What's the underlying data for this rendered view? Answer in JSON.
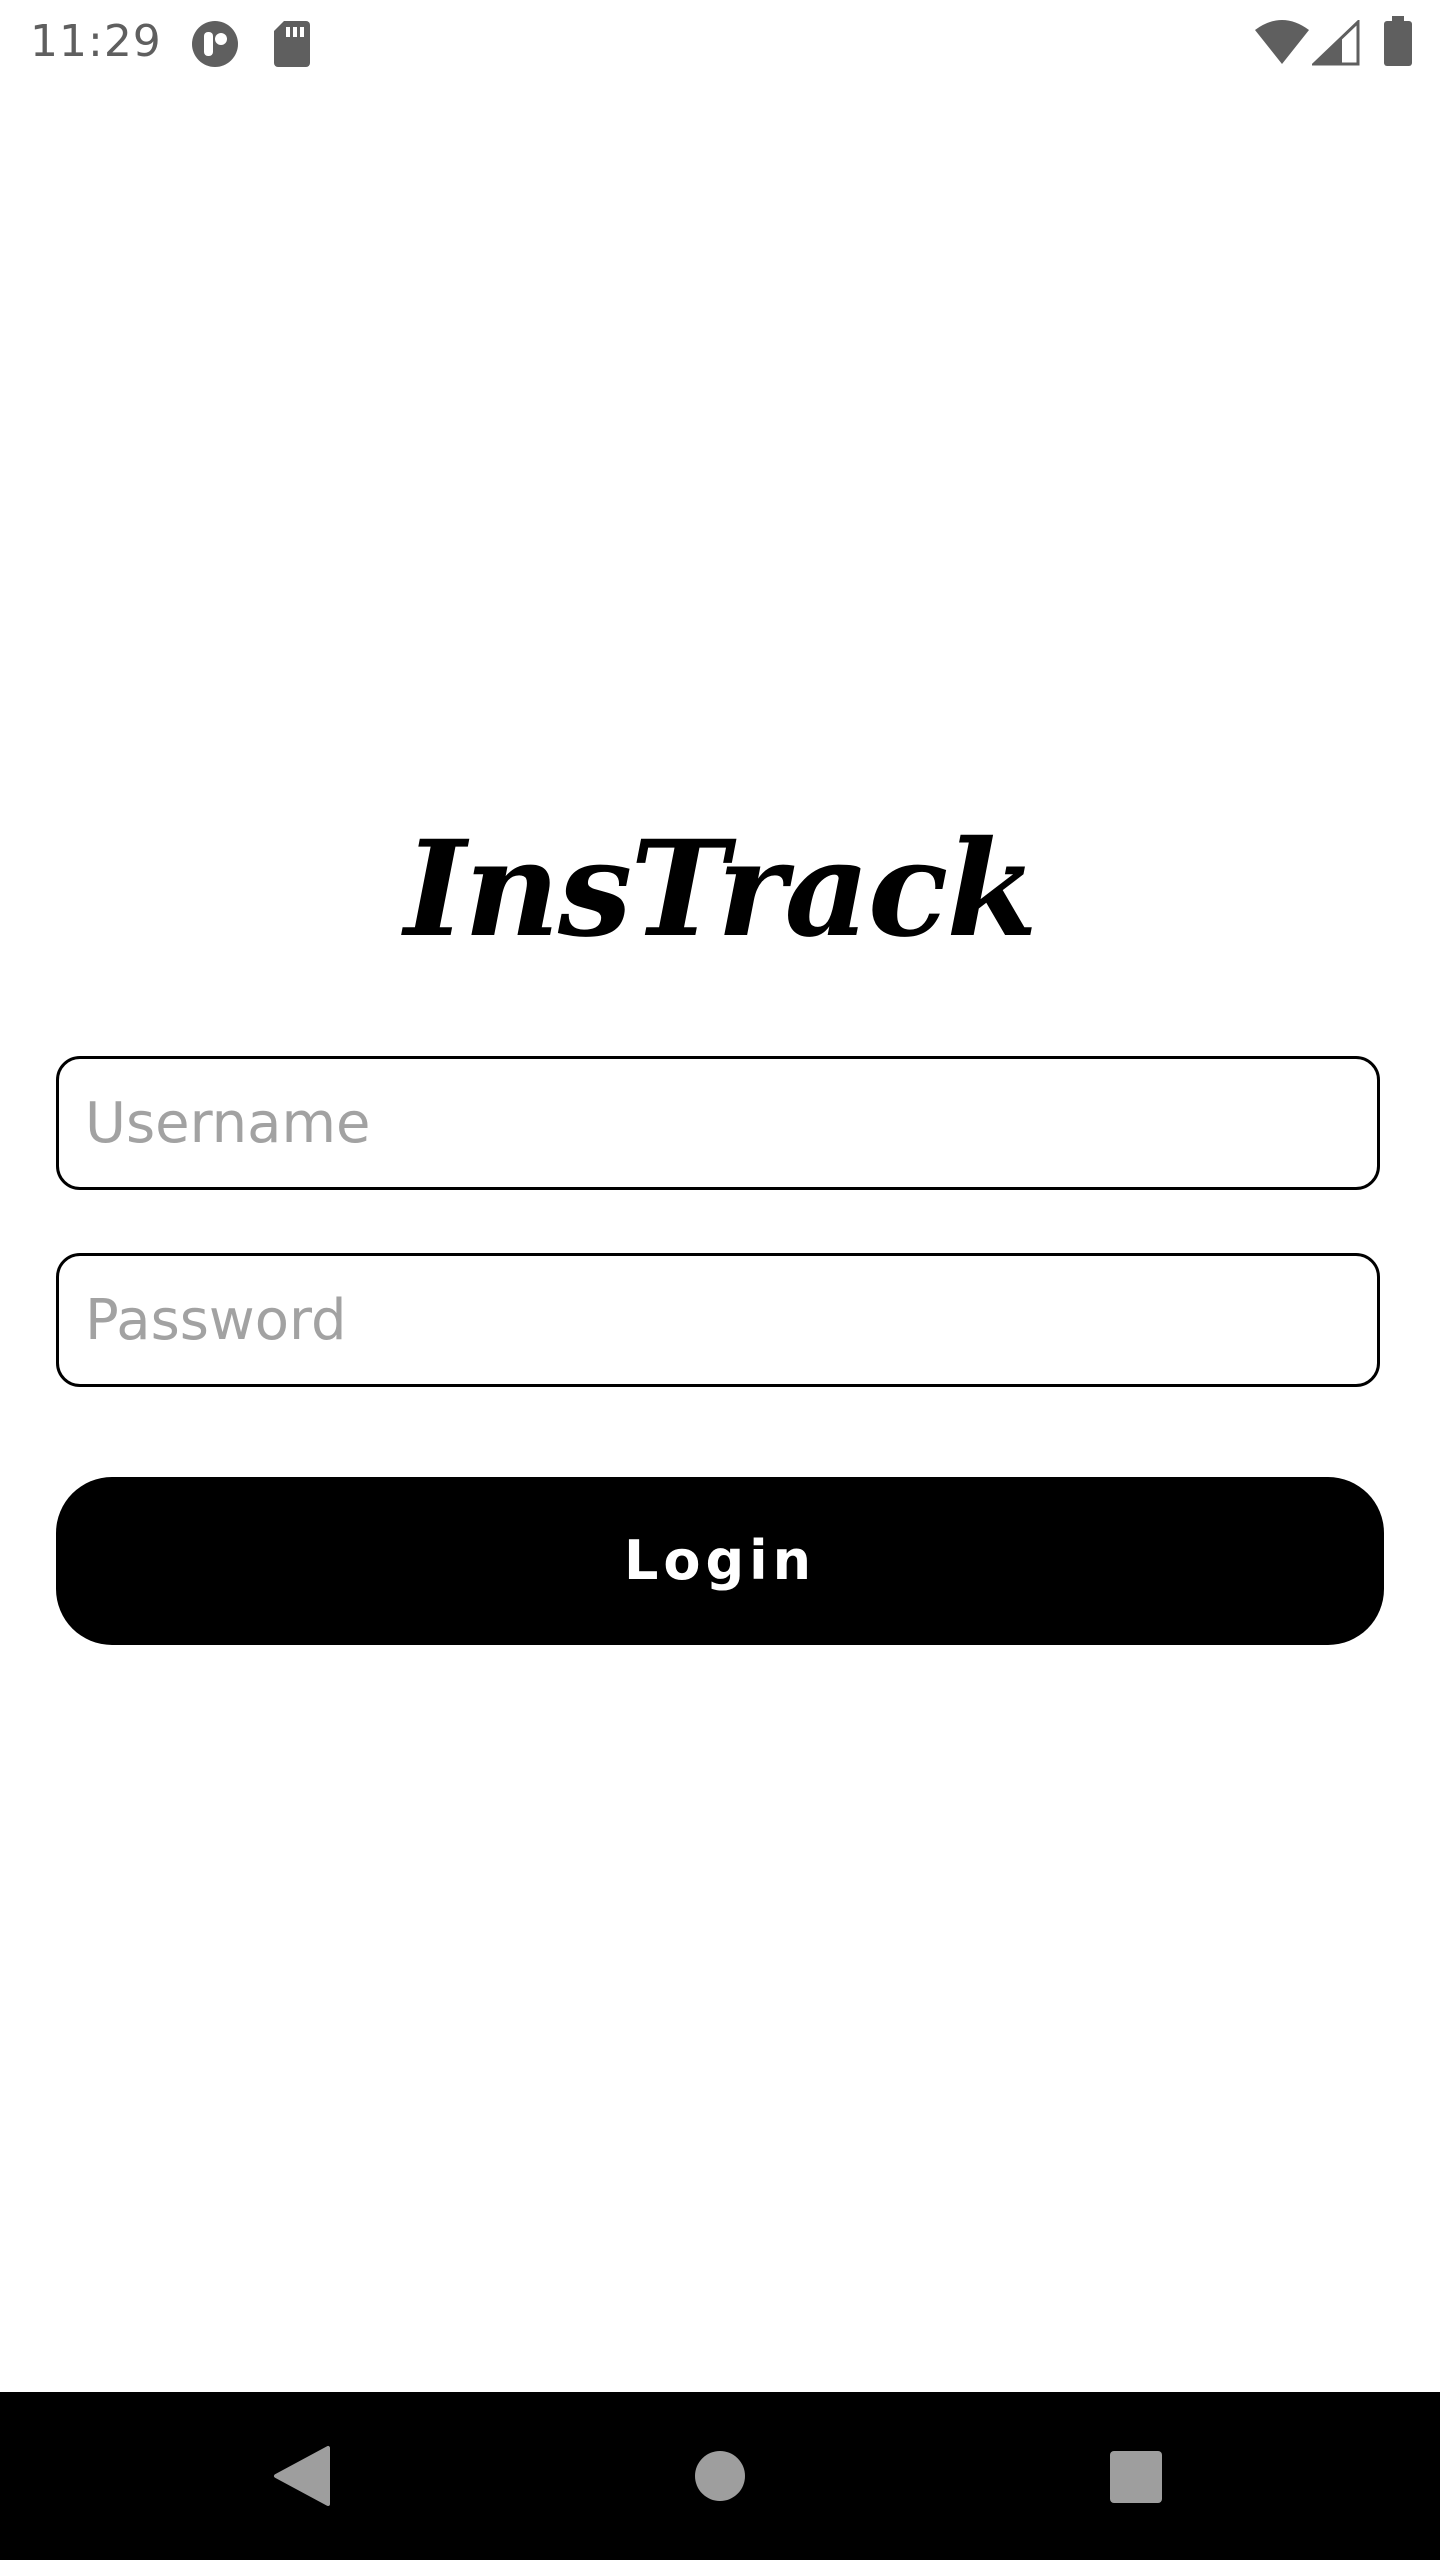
{
  "status_bar": {
    "time": "11:29",
    "icons": [
      "app-notification-icon",
      "sd-card-icon",
      "wifi-icon",
      "cell-signal-icon",
      "battery-icon"
    ]
  },
  "app": {
    "logo_text": "InsTrack"
  },
  "form": {
    "username_placeholder": "Username",
    "username_value": "",
    "password_placeholder": "Password",
    "password_value": "",
    "login_label": "Login"
  },
  "nav_bar": {
    "buttons": [
      "back-icon",
      "home-icon",
      "recents-icon"
    ]
  },
  "colors": {
    "background": "#ffffff",
    "primary": "#000000",
    "placeholder": "#a2a2a2",
    "status_icons": "#5f5f5f",
    "nav_icons": "#9e9e9e"
  }
}
